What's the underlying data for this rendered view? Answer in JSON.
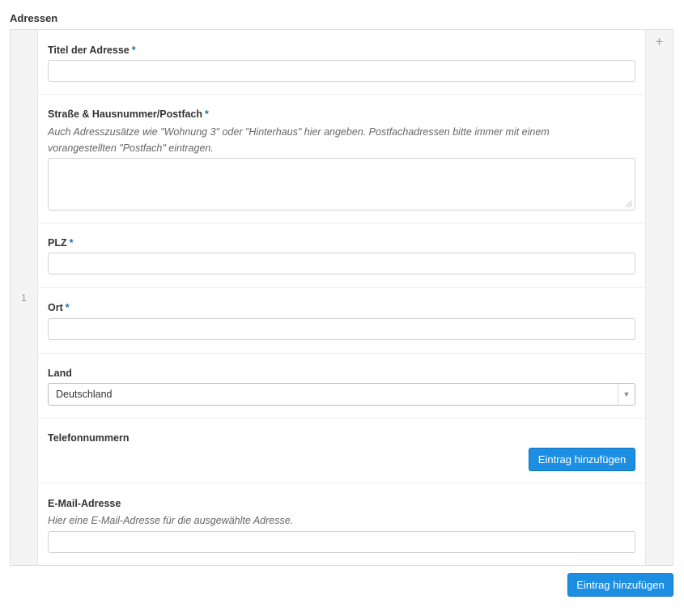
{
  "section": {
    "title": "Adressen"
  },
  "repeater": {
    "row_index": "1",
    "add_row_icon": "plus-icon",
    "add_row_glyph": "+",
    "add_entry_label": "Eintrag hinzufügen"
  },
  "fields": {
    "title": {
      "label": "Titel der Adresse",
      "required": "*",
      "value": ""
    },
    "street": {
      "label": "Straße & Hausnummer/Postfach",
      "required": "*",
      "instructions_line1": "Auch Adresszusätze wie \"Wohnung 3\" oder \"Hinterhaus\" hier angeben. Postfachadressen bitte immer mit einem",
      "instructions_line2": "vorangestellten \"Postfach\" eintragen.",
      "value": ""
    },
    "zip": {
      "label": "PLZ",
      "required": "*",
      "value": ""
    },
    "city": {
      "label": "Ort",
      "required": "*",
      "value": ""
    },
    "country": {
      "label": "Land",
      "selected": "Deutschland",
      "arrow_icon": "chevron-down-icon",
      "arrow_glyph": "▼"
    },
    "phones": {
      "label": "Telefonnummern",
      "add_entry_label": "Eintrag hinzufügen"
    },
    "email": {
      "label": "E-Mail-Adresse",
      "instructions": "Hier eine E-Mail-Adresse für die ausgewählte Adresse.",
      "value": ""
    }
  },
  "colors": {
    "accent": "#1d8fe3",
    "required": "#2271b1"
  }
}
